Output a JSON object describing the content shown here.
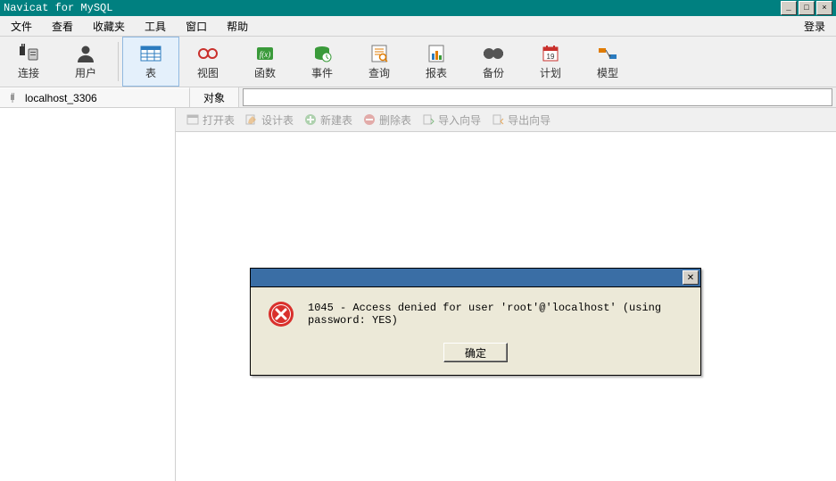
{
  "titlebar": {
    "title": "Navicat for MySQL"
  },
  "menubar": {
    "items": [
      "文件",
      "查看",
      "收藏夹",
      "工具",
      "窗口",
      "帮助"
    ],
    "right": "登录"
  },
  "toolbar": {
    "items": [
      {
        "label": "连接",
        "icon": "plug"
      },
      {
        "label": "用户",
        "icon": "user"
      },
      {
        "label": "表",
        "icon": "table",
        "active": true
      },
      {
        "label": "视图",
        "icon": "view"
      },
      {
        "label": "函数",
        "icon": "fx"
      },
      {
        "label": "事件",
        "icon": "event"
      },
      {
        "label": "查询",
        "icon": "query"
      },
      {
        "label": "报表",
        "icon": "report"
      },
      {
        "label": "备份",
        "icon": "backup"
      },
      {
        "label": "计划",
        "icon": "schedule"
      },
      {
        "label": "模型",
        "icon": "model"
      }
    ]
  },
  "strip": {
    "connection": "localhost_3306",
    "object_tab": "对象"
  },
  "subbar": {
    "items": [
      "打开表",
      "设计表",
      "新建表",
      "删除表",
      "导入向导",
      "导出向导"
    ]
  },
  "dialog": {
    "message": "1045 - Access denied for user 'root'@'localhost' (using password: YES)",
    "ok": "确定"
  }
}
